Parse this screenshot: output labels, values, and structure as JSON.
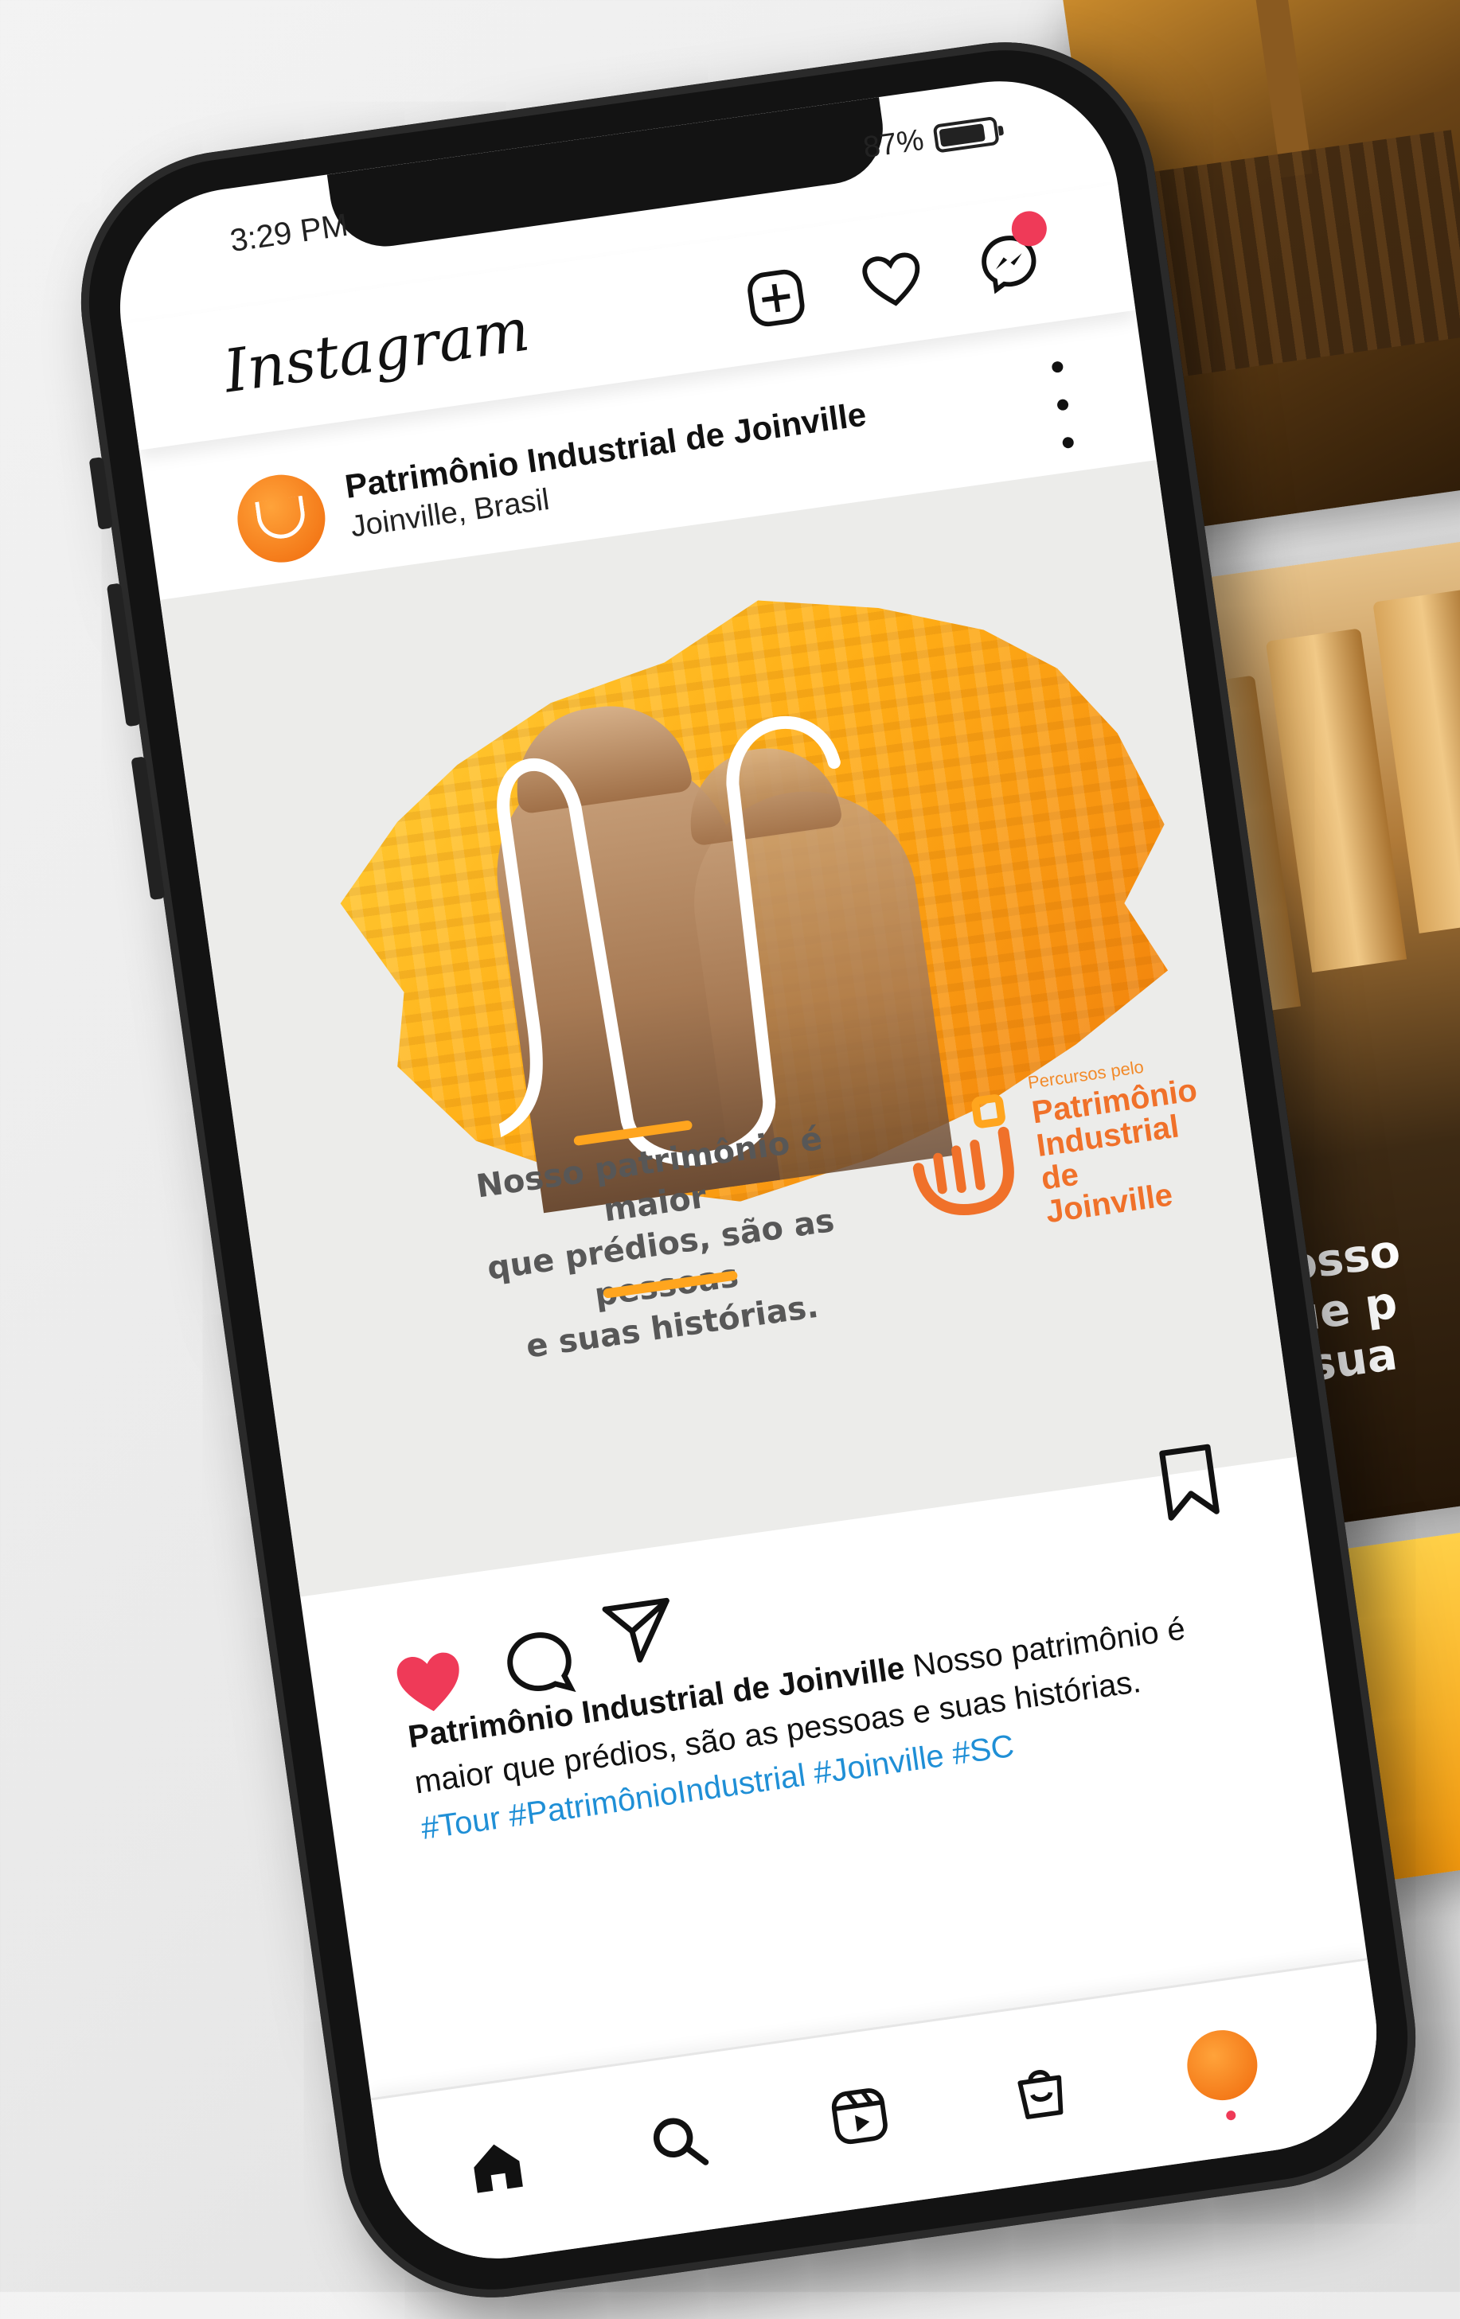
{
  "status": {
    "time": "3:29 PM",
    "battery": "87%"
  },
  "app": {
    "name": "Instagram"
  },
  "post": {
    "author": "Patrimônio Industrial de Joinville",
    "location": "Joinville, Brasil",
    "image": {
      "slogan_lines": [
        "Nosso patrimônio é maior",
        "que prédios, são as pessoas",
        "e suas histórias."
      ],
      "brand_small": "Percursos pelo",
      "brand_lines": [
        "Patrimônio",
        "Industrial",
        "de Joinville"
      ]
    },
    "caption_author": "Patrimônio Industrial de Joinville",
    "caption_text": "Nosso patrimônio é maior que prédios, são as pessoas e suas histórias.",
    "hashtags": "#Tour #PatrimônioIndustrial #Joinville #SC",
    "liked": true
  },
  "background": {
    "peek_text_lines": [
      "Nosso",
      "que p",
      "e sua"
    ]
  },
  "colors": {
    "accent": "#f0712a",
    "like": "#ef3a58",
    "hashtag": "#1f8fd6",
    "brand_yellow": "#ffae16"
  }
}
